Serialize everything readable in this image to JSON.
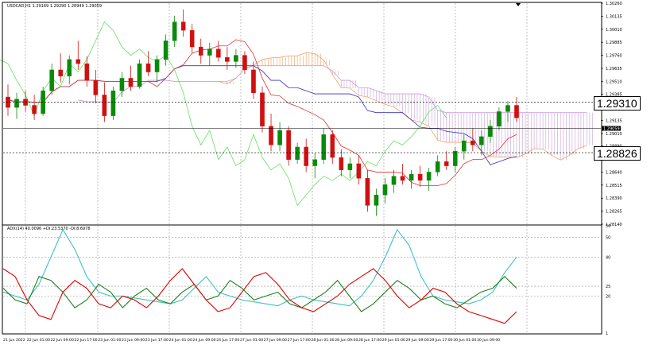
{
  "price_panel": {
    "title": "USDCAD,H1  1.29169 1.29290 1.28949 1.29059",
    "price_labels": [
      "1.30260",
      "1.30135",
      "1.30010",
      "1.29885",
      "1.29760",
      "1.29635",
      "1.29510",
      "1.29385",
      "1.29260",
      "1.29135",
      "1.29010",
      "1.28890",
      "1.28765",
      "1.28640",
      "1.28515",
      "1.28390",
      "1.28265",
      "1.28140"
    ],
    "current_price": "1.29059",
    "level_1": "1.29310",
    "level_2": "1.28826",
    "level_1_tag": "1.29310",
    "level_2_tag": "1.28826"
  },
  "indicator_panel": {
    "title": "ADX(14) 40.0096  +DI:23.5370  -DI:8.6978",
    "scale_labels": [
      "56",
      "50",
      "40",
      "25",
      "20",
      "1"
    ]
  },
  "time_axis": {
    "labels": [
      "21 Jun 2022",
      "22 Jun 01:00",
      "22 Jun 09:00",
      "22 Jun 17:00",
      "23 Jun 01:00",
      "23 Jun 09:00",
      "23 Jun 17:00",
      "24 Jun 01:00",
      "24 Jun 09:00",
      "24 Jun 17:00",
      "27 Jun 01:00",
      "27 Jun 09:00",
      "27 Jun 17:00",
      "28 Jun 01:00",
      "28 Jun 09:00",
      "28 Jun 17:00",
      "29 Jun 01:00",
      "29 Jun 09:00",
      "29 Jun 17:00",
      "30 Jun 01:00",
      "30 Jun 09:00"
    ]
  },
  "colors": {
    "bull": "#0a8a0a",
    "bear": "#d01010",
    "kumo_bear": "#c8a0d8",
    "kumo_bull": "#f0a060",
    "tenkan": "#e03030",
    "kijun": "#3030c0",
    "chikou": "#60e060",
    "adx": "#40c0c0",
    "plus_di": "#208020",
    "minus_di": "#e00000"
  },
  "chart_data": [
    {
      "type": "candlestick",
      "title": "USDCAD,H1",
      "ylim": [
        1.2814,
        1.3026
      ],
      "candles": [
        [
          1.2936,
          1.2948,
          1.2918,
          1.2926
        ],
        [
          1.2926,
          1.294,
          1.2915,
          1.2934
        ],
        [
          1.2934,
          1.2942,
          1.2922,
          1.2928
        ],
        [
          1.2928,
          1.2938,
          1.2914,
          1.292
        ],
        [
          1.292,
          1.2946,
          1.2918,
          1.2942
        ],
        [
          1.2942,
          1.2968,
          1.2938,
          1.2962
        ],
        [
          1.2962,
          1.2978,
          1.295,
          1.2956
        ],
        [
          1.2956,
          1.2976,
          1.2948,
          1.2972
        ],
        [
          1.2972,
          1.299,
          1.2962,
          1.2968
        ],
        [
          1.2968,
          1.2975,
          1.2946,
          1.2952
        ],
        [
          1.2952,
          1.2962,
          1.293,
          1.2938
        ],
        [
          1.2938,
          1.295,
          1.2912,
          1.2918
        ],
        [
          1.2918,
          1.2946,
          1.2914,
          1.2942
        ],
        [
          1.2942,
          1.296,
          1.2936,
          1.2954
        ],
        [
          1.2954,
          1.2966,
          1.2942,
          1.2946
        ],
        [
          1.2946,
          1.2972,
          1.2944,
          1.2968
        ],
        [
          1.2968,
          1.298,
          1.2956,
          1.296
        ],
        [
          1.296,
          1.2976,
          1.295,
          1.2972
        ],
        [
          1.2972,
          1.2996,
          1.2966,
          1.299
        ],
        [
          1.299,
          1.3014,
          1.2984,
          1.3008
        ],
        [
          1.3008,
          1.302,
          1.2994,
          1.3
        ],
        [
          1.3,
          1.3006,
          1.2978,
          1.2984
        ],
        [
          1.2984,
          1.2992,
          1.2968,
          1.2976
        ],
        [
          1.2976,
          1.2988,
          1.2966,
          1.2982
        ],
        [
          1.2982,
          1.299,
          1.297,
          1.2974
        ],
        [
          1.2974,
          1.2984,
          1.2962,
          1.297
        ],
        [
          1.297,
          1.2982,
          1.2964,
          1.2976
        ],
        [
          1.2976,
          1.298,
          1.2958,
          1.2962
        ],
        [
          1.2962,
          1.297,
          1.2934,
          1.294
        ],
        [
          1.294,
          1.2946,
          1.2902,
          1.2908
        ],
        [
          1.2908,
          1.292,
          1.2884,
          1.289
        ],
        [
          1.289,
          1.2912,
          1.2884,
          1.2904
        ],
        [
          1.2904,
          1.2908,
          1.287,
          1.2876
        ],
        [
          1.2876,
          1.2892,
          1.2872,
          1.2888
        ],
        [
          1.2888,
          1.2896,
          1.2864,
          1.287
        ],
        [
          1.287,
          1.2882,
          1.2858,
          1.2876
        ],
        [
          1.2876,
          1.2906,
          1.2872,
          1.29
        ],
        [
          1.29,
          1.2904,
          1.2872,
          1.2878
        ],
        [
          1.2878,
          1.2886,
          1.286,
          1.2866
        ],
        [
          1.2866,
          1.2878,
          1.2858,
          1.2872
        ],
        [
          1.2872,
          1.288,
          1.2852,
          1.2858
        ],
        [
          1.2858,
          1.2866,
          1.2826,
          1.2832
        ],
        [
          1.2832,
          1.2848,
          1.2822,
          1.2842
        ],
        [
          1.2842,
          1.2858,
          1.2834,
          1.2852
        ],
        [
          1.2852,
          1.2866,
          1.2844,
          1.286
        ],
        [
          1.286,
          1.2872,
          1.2852,
          1.2856
        ],
        [
          1.2856,
          1.2866,
          1.2848,
          1.2862
        ],
        [
          1.2862,
          1.287,
          1.285,
          1.2856
        ],
        [
          1.2856,
          1.2868,
          1.2846,
          1.2864
        ],
        [
          1.2864,
          1.288,
          1.286,
          1.2874
        ],
        [
          1.2874,
          1.2884,
          1.2866,
          1.287
        ],
        [
          1.287,
          1.2888,
          1.2864,
          1.2884
        ],
        [
          1.2884,
          1.29,
          1.2876,
          1.2894
        ],
        [
          1.2894,
          1.2906,
          1.2884,
          1.289
        ],
        [
          1.289,
          1.2904,
          1.288,
          1.2898
        ],
        [
          1.2898,
          1.2914,
          1.2892,
          1.2908
        ],
        [
          1.2908,
          1.2926,
          1.2904,
          1.2922
        ],
        [
          1.2922,
          1.2932,
          1.2912,
          1.2928
        ],
        [
          1.2928,
          1.2936,
          1.2912,
          1.2916
        ]
      ]
    },
    {
      "type": "line",
      "title": "ADX(14) 40.0096  +DI:23.5370  -DI:8.6978",
      "ylim": [
        1,
        56
      ],
      "series": [
        {
          "name": "ADX(14)",
          "values": [
            22,
            20,
            18,
            26,
            40,
            54,
            44,
            30,
            22,
            20,
            20,
            19,
            18,
            17,
            16,
            18,
            24,
            30,
            22,
            20,
            18,
            17,
            16,
            15,
            18,
            20,
            18,
            17,
            16,
            15,
            20,
            28,
            40,
            54,
            46,
            30,
            20,
            18,
            17,
            16,
            18,
            22,
            32,
            40
          ]
        },
        {
          "name": "+DI",
          "values": [
            24,
            18,
            16,
            30,
            28,
            22,
            14,
            18,
            26,
            22,
            14,
            20,
            24,
            18,
            16,
            22,
            26,
            18,
            20,
            28,
            24,
            18,
            20,
            22,
            16,
            14,
            18,
            22,
            28,
            20,
            12,
            16,
            22,
            28,
            24,
            18,
            20,
            16,
            14,
            18,
            22,
            24,
            30,
            24
          ]
        },
        {
          "name": "-DI",
          "values": [
            34,
            30,
            18,
            10,
            8,
            22,
            28,
            24,
            16,
            14,
            20,
            18,
            14,
            20,
            28,
            34,
            26,
            18,
            12,
            14,
            22,
            30,
            32,
            26,
            18,
            14,
            12,
            16,
            20,
            26,
            30,
            34,
            28,
            20,
            14,
            18,
            24,
            22,
            16,
            12,
            10,
            8,
            6,
            12
          ]
        }
      ]
    }
  ]
}
